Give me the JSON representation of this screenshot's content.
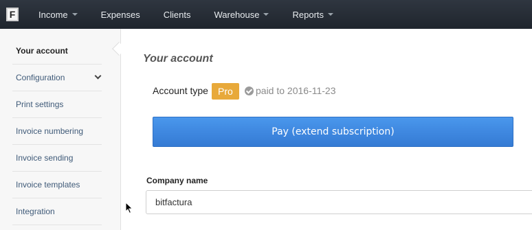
{
  "navbar": {
    "logo_letter": "F",
    "items": [
      {
        "label": "Income",
        "dropdown": true
      },
      {
        "label": "Expenses",
        "dropdown": false
      },
      {
        "label": "Clients",
        "dropdown": false
      },
      {
        "label": "Warehouse",
        "dropdown": true
      },
      {
        "label": "Reports",
        "dropdown": true
      }
    ]
  },
  "sidebar": {
    "items": [
      {
        "label": "Your account",
        "active": true
      },
      {
        "label": "Configuration",
        "expandable": true
      },
      {
        "label": "Print settings"
      },
      {
        "label": "Invoice numbering"
      },
      {
        "label": "Invoice sending"
      },
      {
        "label": "Invoice templates"
      },
      {
        "label": "Integration"
      }
    ]
  },
  "main": {
    "title": "Your account",
    "account_type_label": "Account type",
    "plan_badge": "Pro",
    "paid_text": "paid to 2016-11-23",
    "pay_button": "Pay (extend subscription)",
    "company_name_label": "Company name",
    "company_name_value": "bitfactura"
  },
  "colors": {
    "navbar_bg": "#262c34",
    "badge": "#e8a93a",
    "primary_button": "#3f88e0"
  }
}
